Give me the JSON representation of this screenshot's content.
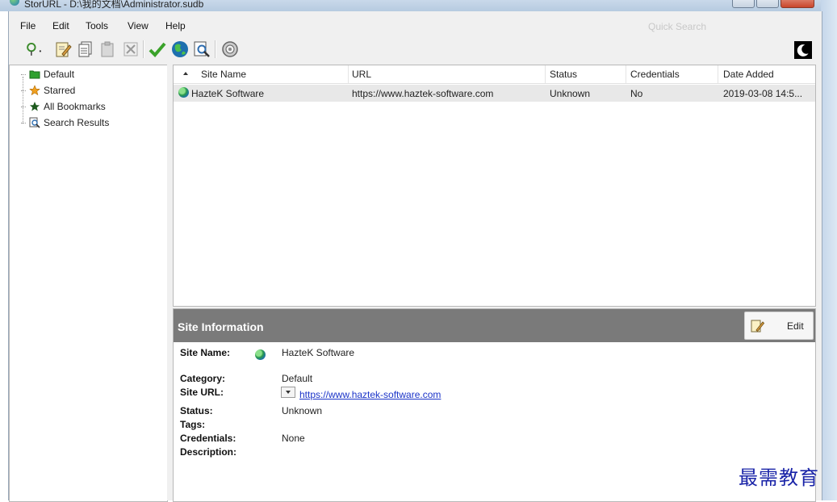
{
  "window": {
    "title": "StorURL - D:\\我的文档\\Administrator.sudb"
  },
  "menu": {
    "items": [
      "File",
      "Edit",
      "Tools",
      "View",
      "Help"
    ]
  },
  "search": {
    "placeholder": "Quick Search"
  },
  "toolbar": {
    "buttons": [
      "add-bookmark-icon",
      "edit-icon",
      "copy-icon",
      "paste-icon",
      "delete-icon",
      "check-icon",
      "globe-icon",
      "find-icon",
      "settings-icon"
    ],
    "theme_icon": "moon-icon"
  },
  "tree": {
    "items": [
      {
        "label": "Default",
        "icon": "folder-icon"
      },
      {
        "label": "Starred",
        "icon": "star-icon"
      },
      {
        "label": "All Bookmarks",
        "icon": "star-icon"
      },
      {
        "label": "Search Results",
        "icon": "search-results-icon"
      }
    ]
  },
  "list": {
    "columns": [
      "Site Name",
      "URL",
      "Status",
      "Credentials",
      "Date Added"
    ],
    "rows": [
      {
        "site_name": "HazteK Software",
        "url": "https://www.haztek-software.com",
        "status": "Unknown",
        "credentials": "No",
        "date_added": "2019-03-08 14:5..."
      }
    ]
  },
  "info": {
    "title": "Site Information",
    "edit_label": "Edit",
    "labels": {
      "site_name": "Site Name:",
      "category": "Category:",
      "site_url": "Site URL:",
      "status": "Status:",
      "tags": "Tags:",
      "credentials": "Credentials:",
      "description": "Description:"
    },
    "values": {
      "site_name": "HazteK Software",
      "category": "Default",
      "site_url": "https://www.haztek-software.com",
      "status": "Unknown",
      "credentials": "None"
    }
  },
  "watermark": "最需教育",
  "colors": {
    "info_header": "#7a7a7a",
    "link": "#1a33c8",
    "selected_row": "#e8e8e8",
    "watermark": "#1a24a8"
  }
}
